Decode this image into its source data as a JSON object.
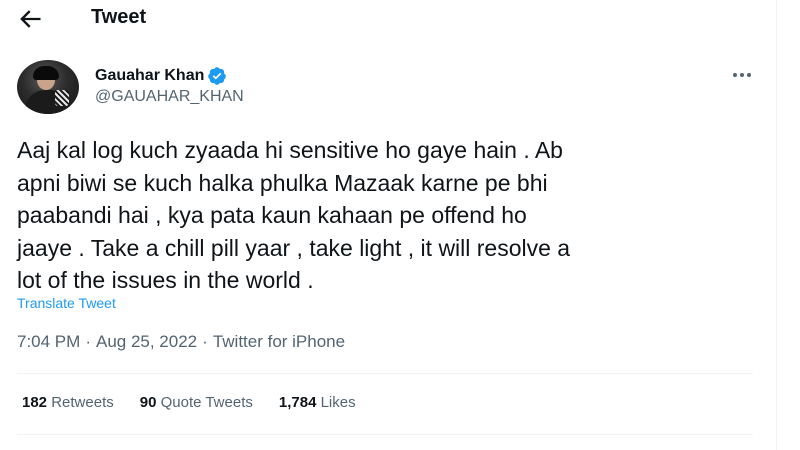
{
  "header": {
    "title": "Tweet",
    "back_icon": "arrow-left-icon"
  },
  "author": {
    "display_name": "Gauahar Khan",
    "handle": "@GAUAHAR_KHAN",
    "verified": true,
    "verified_color": "#1d9bf0"
  },
  "tweet": {
    "text": "Aaj kal log kuch zyaada hi sensitive ho gaye hain . Ab\napni biwi se kuch halka phulka Mazaak karne pe bhi\npaabandi hai , kya pata kaun kahaan pe offend ho\njaaye . Take a chill pill yaar , take light , it will resolve a\nlot of the issues in the world .",
    "translate_label": "Translate Tweet",
    "time": "7:04 PM",
    "separator": "·",
    "date": "Aug 25, 2022",
    "source": "Twitter for iPhone"
  },
  "stats": {
    "retweets_count": "182",
    "retweets_label": "Retweets",
    "quotes_count": "90",
    "quotes_label": "Quote Tweets",
    "likes_count": "1,784",
    "likes_label": "Likes"
  },
  "colors": {
    "accent": "#1d9bf0",
    "secondary_text": "#536471",
    "primary_text": "#0f1419"
  }
}
